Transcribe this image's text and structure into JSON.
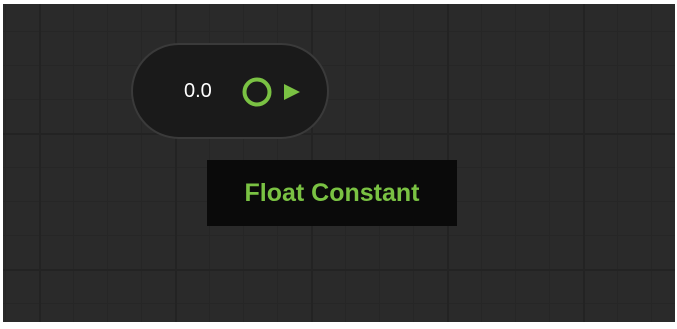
{
  "node": {
    "value": "0.0"
  },
  "tooltip": {
    "label": "Float Constant"
  },
  "colors": {
    "accent": "#7ac243",
    "canvas_bg": "#2a2a2a",
    "node_bg": "#1a1a1a",
    "tooltip_bg": "#0a0a0a"
  },
  "icons": {
    "output_port": "output-port-icon"
  }
}
